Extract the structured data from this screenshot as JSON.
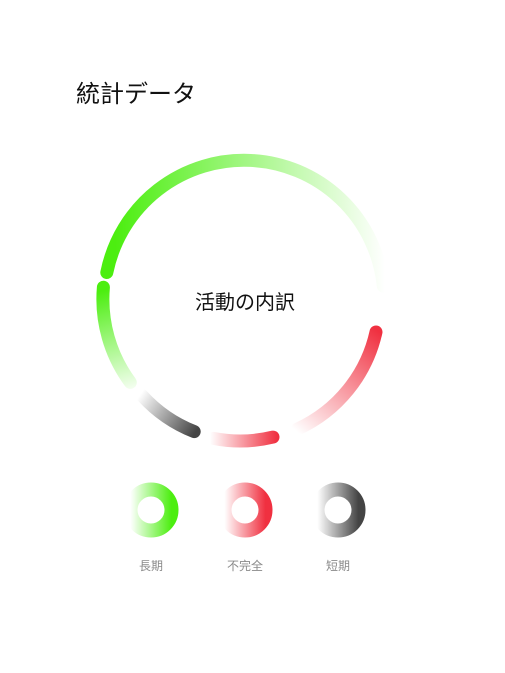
{
  "header": {
    "title": "統計データ"
  },
  "activity_ring": {
    "center_label": "活動の内訳",
    "segments": [
      {
        "name": "長期",
        "color": "#4cee10",
        "fade": "#ffffff"
      },
      {
        "name": "不完全",
        "color": "#f03040",
        "fade": "#ffffff"
      },
      {
        "name": "短期",
        "color": "#555555",
        "fade": "#ffffff"
      }
    ]
  },
  "legend": {
    "items": [
      {
        "label": "長期",
        "color": "#4cee10"
      },
      {
        "label": "不完全",
        "color": "#f03040"
      },
      {
        "label": "短期",
        "color": "#555555"
      }
    ]
  },
  "colors": {
    "long_term": "#4cee10",
    "incomplete": "#f03040",
    "short_term": "#555555",
    "background": "#ffffff"
  }
}
